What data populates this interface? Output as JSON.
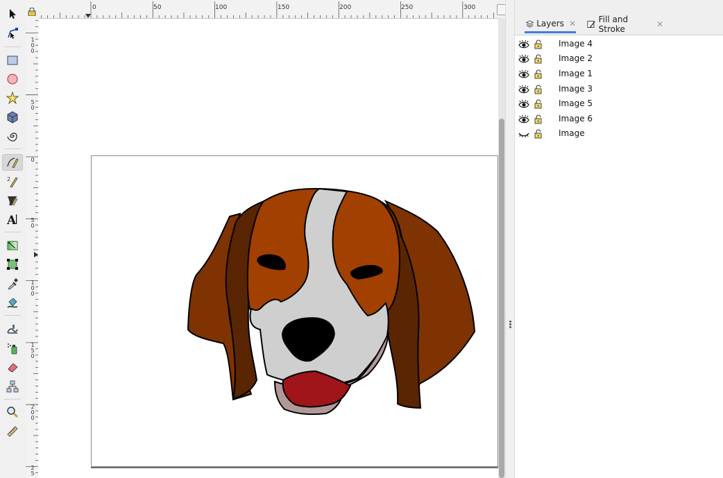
{
  "ruler": {
    "top_labels": [
      "0",
      "50",
      "100",
      "150",
      "200",
      "250",
      "300"
    ],
    "left_labels": [
      "1\n0\n0",
      "5\n0",
      "0",
      "5\n0",
      "1\n0\n0",
      "1\n5\n0",
      "2\n0\n0",
      "2\n5"
    ]
  },
  "tools": [
    {
      "name": "selector-tool",
      "icon": "arrow-icon"
    },
    {
      "name": "node-tool",
      "icon": "node-icon"
    },
    {
      "name": "rectangle-tool",
      "icon": "rectangle-icon"
    },
    {
      "name": "ellipse-tool",
      "icon": "circle-icon"
    },
    {
      "name": "star-tool",
      "icon": "star-icon"
    },
    {
      "name": "3d-box-tool",
      "icon": "box-icon"
    },
    {
      "name": "spiral-tool",
      "icon": "spiral-icon"
    },
    {
      "name": "bezier-tool",
      "icon": "pen-icon",
      "active": true
    },
    {
      "name": "pencil-tool",
      "icon": "pencil-icon"
    },
    {
      "name": "calligraphy-tool",
      "icon": "calligraphy-icon"
    },
    {
      "name": "text-tool",
      "icon": "text-icon",
      "label": "A"
    },
    {
      "name": "gradient-tool",
      "icon": "gradient-icon"
    },
    {
      "name": "mesh-tool",
      "icon": "mesh-icon"
    },
    {
      "name": "dropper-tool",
      "icon": "dropper-icon"
    },
    {
      "name": "paint-bucket-tool",
      "icon": "bucket-icon"
    },
    {
      "name": "tweak-tool",
      "icon": "tweak-icon"
    },
    {
      "name": "spray-tool",
      "icon": "spray-icon"
    },
    {
      "name": "eraser-tool",
      "icon": "eraser-icon"
    },
    {
      "name": "connector-tool",
      "icon": "connector-icon"
    },
    {
      "name": "zoom-tool",
      "icon": "zoom-icon"
    },
    {
      "name": "measure-tool",
      "icon": "measure-icon"
    }
  ],
  "dock": {
    "tabs": [
      {
        "label": "Layers",
        "icon": "layers-icon",
        "active": true
      },
      {
        "label": "Fill and Stroke",
        "icon": "fill-stroke-icon",
        "active": false
      }
    ],
    "close_glyph": "✕",
    "layers": [
      {
        "name": "Image 4",
        "visible": true,
        "locked": false
      },
      {
        "name": "Image 2",
        "visible": true,
        "locked": false
      },
      {
        "name": "Image 1",
        "visible": true,
        "locked": false
      },
      {
        "name": "Image 3",
        "visible": true,
        "locked": false
      },
      {
        "name": "Image 5",
        "visible": true,
        "locked": false
      },
      {
        "name": "Image 6",
        "visible": true,
        "locked": false
      },
      {
        "name": "Image",
        "visible": false,
        "locked": false
      }
    ]
  },
  "colors": {
    "ear_dark": "#5a2503",
    "ear_outer": "#7f3302",
    "head_brown": "#a14000",
    "blaze_gray": "#cfcfcf",
    "muzzle_shadow": "#b29999",
    "tongue": "#a0151a",
    "nose": "#000000",
    "accent": "#3b7fd6"
  }
}
